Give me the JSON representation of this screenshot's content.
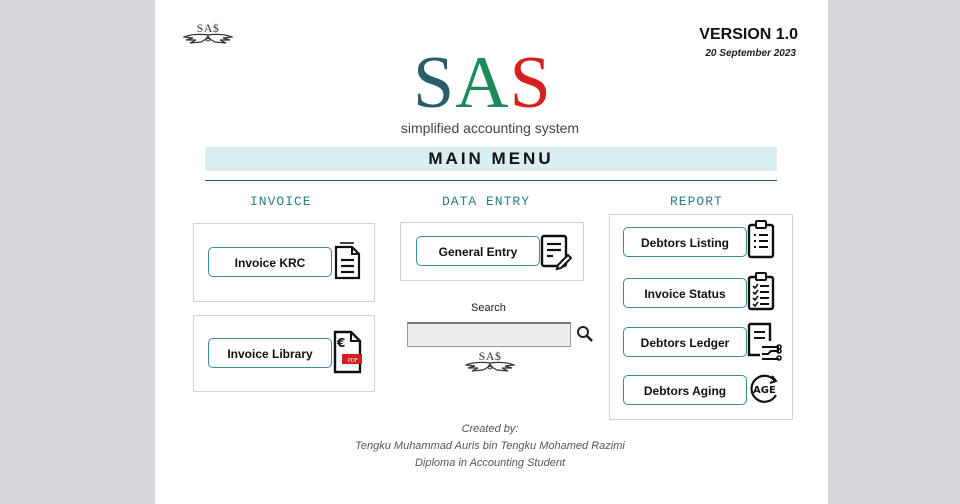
{
  "header": {
    "mini_logo": "SA$",
    "version": "VERSION 1.0",
    "date": "20 September 2023"
  },
  "logo": {
    "s1": "S",
    "a": "A",
    "s2": "S",
    "tagline": "simplified accounting system"
  },
  "menu": {
    "title": "MAIN MENU"
  },
  "sections": {
    "invoice": {
      "title": "INVOICE",
      "buttons": [
        {
          "label": "Invoice KRC",
          "icon": "document-icon"
        },
        {
          "label": "Invoice Library",
          "icon": "pdf-euro-icon"
        }
      ]
    },
    "data_entry": {
      "title": "DATA ENTRY",
      "buttons": [
        {
          "label": "General Entry",
          "icon": "edit-document-icon"
        }
      ],
      "search": {
        "label": "Search",
        "value": "",
        "placeholder": "",
        "icon": "search-icon"
      },
      "mini_logo": "SA$"
    },
    "report": {
      "title": "REPORT",
      "buttons": [
        {
          "label": "Debtors Listing",
          "icon": "clipboard-list-icon"
        },
        {
          "label": "Invoice Status",
          "icon": "clipboard-check-icon"
        },
        {
          "label": "Debtors Ledger",
          "icon": "ledger-icon"
        },
        {
          "label": "Debtors Aging",
          "icon": "age-icon"
        }
      ]
    }
  },
  "credits": {
    "line1": "Created by:",
    "line2": "Tengku Muhammad Auris bin Tengku Mohamed Razimi",
    "line3": "Diploma in Accounting Student"
  },
  "colors": {
    "accent": "#2c7c86",
    "logo_s1": "#2a5d6a",
    "logo_a": "#1d8a5b",
    "logo_s2": "#d42020",
    "menu_bg": "#daeef0"
  }
}
